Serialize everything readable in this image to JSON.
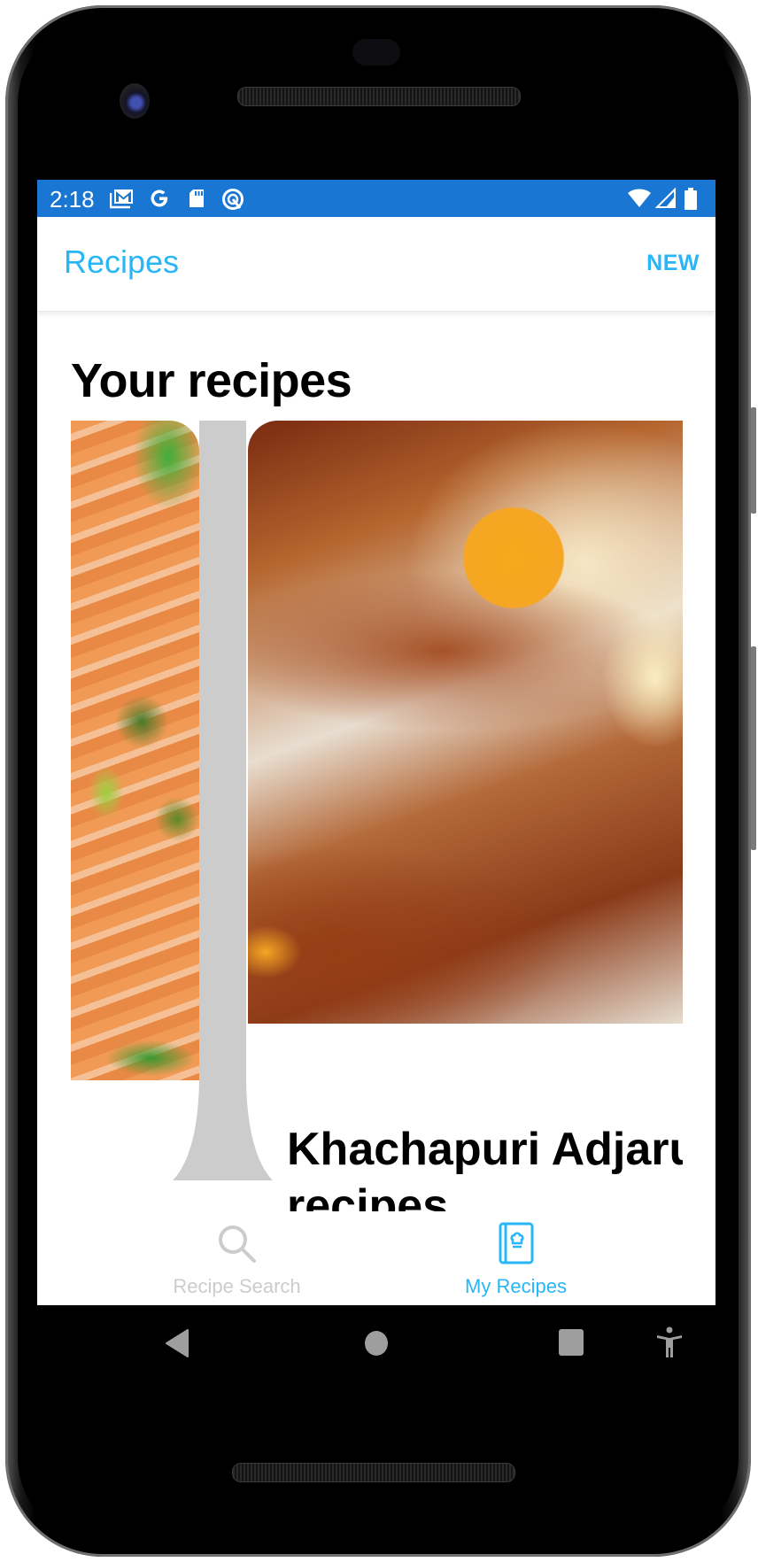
{
  "status_bar": {
    "time": "2:18",
    "left_icons": [
      "gmail-icon",
      "google-icon",
      "sd-card-icon",
      "data-saver-icon"
    ],
    "right_icons": [
      "wifi-icon",
      "cell-signal-icon",
      "battery-icon"
    ],
    "color": "#1976D2"
  },
  "header": {
    "title": "Recipes",
    "action_label": "NEW",
    "accent_color": "#29B6F6"
  },
  "main": {
    "section_title": "Your recipes",
    "cards": [
      {
        "title": "",
        "image": "salmon-dish-image",
        "partial": true
      },
      {
        "title_line1": "Khachapuri Adjaru",
        "title_line2": "recipes",
        "image": "khachapuri-image"
      }
    ]
  },
  "bottom_nav": {
    "items": [
      {
        "label": "Recipe Search",
        "icon": "search-icon",
        "active": false,
        "color": "#CCCCCC"
      },
      {
        "label": "My Recipes",
        "icon": "recipe-book-icon",
        "active": true,
        "color": "#29B6F6"
      }
    ]
  },
  "system_nav": {
    "buttons": [
      "back-button",
      "home-button",
      "recents-button",
      "accessibility-button"
    ]
  }
}
